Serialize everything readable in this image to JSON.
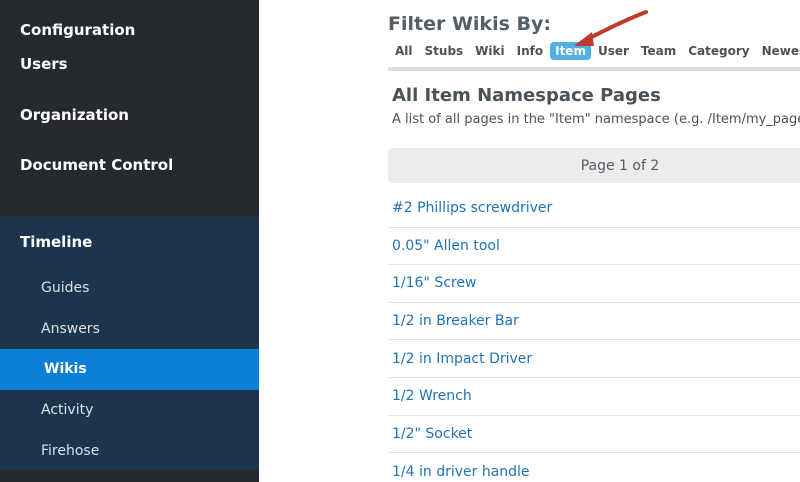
{
  "sidebar": {
    "items": [
      {
        "label": "Configuration"
      },
      {
        "label": "Users"
      },
      {
        "label": "Organization"
      },
      {
        "label": "Document Control"
      }
    ],
    "timeline": {
      "label": "Timeline",
      "sub_items": [
        {
          "label": "Guides"
        },
        {
          "label": "Answers"
        },
        {
          "label": "Wikis",
          "active": true
        },
        {
          "label": "Activity"
        },
        {
          "label": "Firehose"
        }
      ]
    }
  },
  "filter": {
    "title": "Filter Wikis By:",
    "tabs": [
      {
        "label": "All"
      },
      {
        "label": "Stubs"
      },
      {
        "label": "Wiki"
      },
      {
        "label": "Info"
      },
      {
        "label": "Item",
        "active": true
      },
      {
        "label": "User"
      },
      {
        "label": "Team"
      },
      {
        "label": "Category"
      },
      {
        "label": "Newest"
      }
    ]
  },
  "section": {
    "title": "All Item Namespace Pages",
    "description": "A list of all pages in the \"Item\" namespace (e.g. /Item/my_page) tha"
  },
  "pager": {
    "label": "Page 1 of 2"
  },
  "pages": [
    {
      "label": "#2 Phillips screwdriver"
    },
    {
      "label": "0.05\" Allen tool"
    },
    {
      "label": "1/16\" Screw"
    },
    {
      "label": "1/2 in Breaker Bar"
    },
    {
      "label": "1/2 in Impact Driver"
    },
    {
      "label": "1/2 Wrench"
    },
    {
      "label": "1/2\" Socket"
    },
    {
      "label": "1/4 in driver handle"
    }
  ],
  "colors": {
    "sidebar_bg": "#262a2e",
    "timeline_bg": "#1d354c",
    "active_nav": "#0d7fd6",
    "active_tab": "#52b0e4",
    "link": "#1f73b7",
    "annotation_arrow": "#c0392b"
  }
}
